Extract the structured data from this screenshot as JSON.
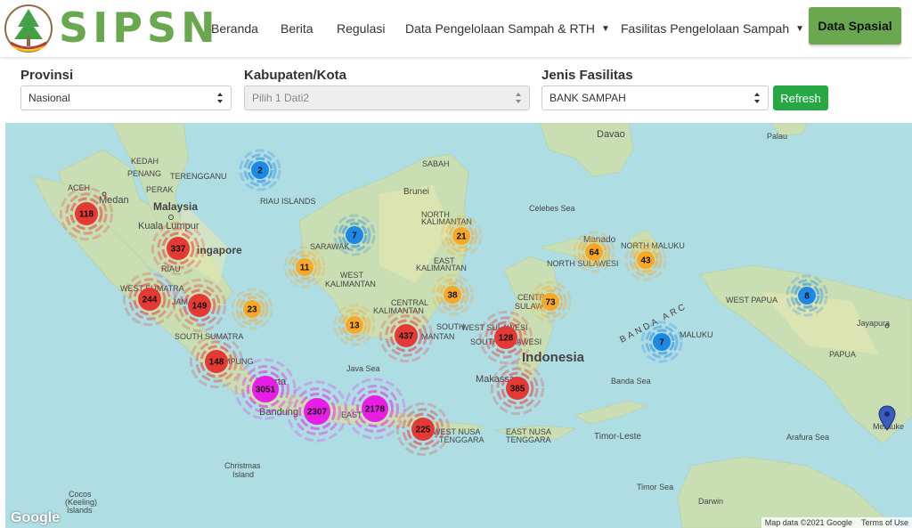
{
  "brand": {
    "name": "SIPSN"
  },
  "nav": {
    "items": [
      {
        "label": "Beranda"
      },
      {
        "label": "Berita"
      },
      {
        "label": "Regulasi"
      },
      {
        "label": "Data Pengelolaan Sampah & RTH"
      },
      {
        "label": "Fasilitas Pengelolaan Sampah"
      }
    ],
    "active_label": "Data Spasial"
  },
  "filters": {
    "provinsi": {
      "label": "Provinsi",
      "value": "Nasional"
    },
    "kabupaten": {
      "label": "Kabupaten/Kota",
      "value": "Pilih 1 Dati2"
    },
    "jenis": {
      "label": "Jenis Fasilitas",
      "value": "BANK SAMPAH"
    },
    "refresh_label": "Refresh"
  },
  "map": {
    "clusters": [
      {
        "count": "2",
        "color": "#1e88e5"
      },
      {
        "count": "118",
        "color": "#e53935"
      },
      {
        "count": "337",
        "color": "#e53935"
      },
      {
        "count": "7",
        "color": "#1e88e5"
      },
      {
        "count": "21",
        "color": "#f9a825"
      },
      {
        "count": "11",
        "color": "#f9a825"
      },
      {
        "count": "64",
        "color": "#f9a825"
      },
      {
        "count": "43",
        "color": "#f9a825"
      },
      {
        "count": "244",
        "color": "#e53935"
      },
      {
        "count": "149",
        "color": "#e53935"
      },
      {
        "count": "23",
        "color": "#f9a825"
      },
      {
        "count": "38",
        "color": "#f9a825"
      },
      {
        "count": "73",
        "color": "#f9a825"
      },
      {
        "count": "8",
        "color": "#1e88e5"
      },
      {
        "count": "13",
        "color": "#f9a825"
      },
      {
        "count": "437",
        "color": "#e53935"
      },
      {
        "count": "128",
        "color": "#e53935"
      },
      {
        "count": "7",
        "color": "#1e88e5"
      },
      {
        "count": "148",
        "color": "#e53935"
      },
      {
        "count": "3051",
        "color": "#e91ee6"
      },
      {
        "count": "2307",
        "color": "#e91ee6"
      },
      {
        "count": "2178",
        "color": "#e91ee6"
      },
      {
        "count": "385",
        "color": "#e53935"
      },
      {
        "count": "225",
        "color": "#e53935"
      }
    ],
    "labels": [
      {
        "text": "Davao"
      },
      {
        "text": "Palau"
      },
      {
        "text": "KEDAH"
      },
      {
        "text": "PENANG"
      },
      {
        "text": "TERENGGANU"
      },
      {
        "text": "SABAH"
      },
      {
        "text": "PERAK"
      },
      {
        "text": "ACEH"
      },
      {
        "text": "Medan"
      },
      {
        "text": "Malaysia"
      },
      {
        "text": "Kuala Lumpur"
      },
      {
        "text": "RIAU ISLANDS"
      },
      {
        "text": "Brunei"
      },
      {
        "text": "NORTH"
      },
      {
        "text": "KALIMANTAN"
      },
      {
        "text": "Celebes Sea"
      },
      {
        "text": "SARAWAK"
      },
      {
        "text": "ingapore"
      },
      {
        "text": "Manado"
      },
      {
        "text": "NORTH MALUKU"
      },
      {
        "text": "NORTH SULAWESI"
      },
      {
        "text": "EAST"
      },
      {
        "text": "KALIMANTAN"
      },
      {
        "text": "RIAU"
      },
      {
        "text": "WEST"
      },
      {
        "text": "KALIMANTAN"
      },
      {
        "text": "WEST SUMATRA"
      },
      {
        "text": "JAM"
      },
      {
        "text": "CENTRAL"
      },
      {
        "text": "KALIMANTAN"
      },
      {
        "text": "CENTR"
      },
      {
        "text": "SULAW"
      },
      {
        "text": "WEST PAPUA"
      },
      {
        "text": "BANDA ARC"
      },
      {
        "text": "Jayapura"
      },
      {
        "text": "SOUTH SUMATRA"
      },
      {
        "text": "SOUTH"
      },
      {
        "text": "MANTAN"
      },
      {
        "text": "WEST SULAWESI"
      },
      {
        "text": "SOUTH SULAWESI"
      },
      {
        "text": "MALUKU"
      },
      {
        "text": "Indonesia"
      },
      {
        "text": "PAPUA"
      },
      {
        "text": "MPUNG"
      },
      {
        "text": "Java Sea"
      },
      {
        "text": "Makassar"
      },
      {
        "text": "Banda Sea"
      },
      {
        "text": "Jakarta"
      },
      {
        "text": "Bandung"
      },
      {
        "text": "EAST"
      },
      {
        "text": "WEST NUSA"
      },
      {
        "text": "TENGGARA"
      },
      {
        "text": "EAST NUSA"
      },
      {
        "text": "TENGGARA"
      },
      {
        "text": "Timor-Leste"
      },
      {
        "text": "Arafura Sea"
      },
      {
        "text": "Merauke"
      },
      {
        "text": "Christmas"
      },
      {
        "text": "Island"
      },
      {
        "text": "Timor Sea"
      },
      {
        "text": "Cocos"
      },
      {
        "text": "(Keeling)"
      },
      {
        "text": "Islands"
      },
      {
        "text": "Darwin"
      }
    ],
    "google_logo": "Google",
    "attribution": "Map data ©2021 Google",
    "terms": "Terms of Use"
  }
}
